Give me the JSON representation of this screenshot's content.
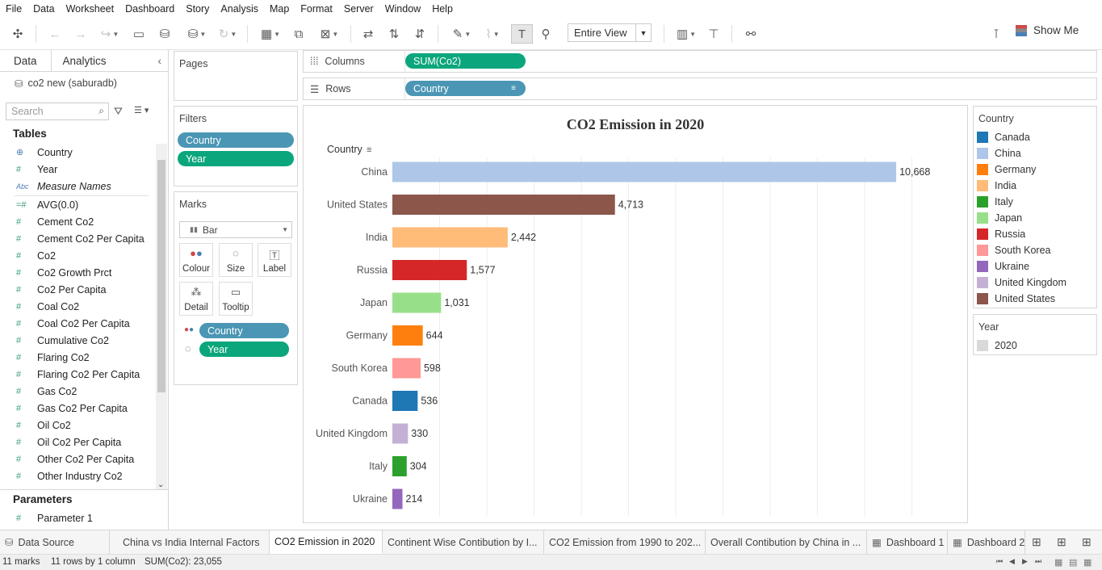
{
  "menu": [
    "File",
    "Data",
    "Worksheet",
    "Dashboard",
    "Story",
    "Analysis",
    "Map",
    "Format",
    "Server",
    "Window",
    "Help"
  ],
  "toolbar": {
    "fit_mode": "Entire View",
    "show_me": "Show Me"
  },
  "left_pane": {
    "tabs": [
      "Data",
      "Analytics"
    ],
    "datasource": "co2 new (saburadb)",
    "search_placeholder": "Search",
    "tables_heading": "Tables",
    "fields": [
      {
        "icon": "globe",
        "name": "Country"
      },
      {
        "icon": "#",
        "name": "Year"
      },
      {
        "icon": "Abc",
        "name": "Measure Names",
        "italic": true
      },
      {
        "icon": "=#",
        "name": "AVG(0.0)"
      },
      {
        "icon": "#",
        "name": "Cement Co2"
      },
      {
        "icon": "#",
        "name": "Cement Co2 Per Capita"
      },
      {
        "icon": "#",
        "name": "Co2"
      },
      {
        "icon": "#",
        "name": "Co2 Growth Prct"
      },
      {
        "icon": "#",
        "name": "Co2 Per Capita"
      },
      {
        "icon": "#",
        "name": "Coal Co2"
      },
      {
        "icon": "#",
        "name": "Coal Co2 Per Capita"
      },
      {
        "icon": "#",
        "name": "Cumulative Co2"
      },
      {
        "icon": "#",
        "name": "Flaring Co2"
      },
      {
        "icon": "#",
        "name": "Flaring Co2 Per Capita"
      },
      {
        "icon": "#",
        "name": "Gas Co2"
      },
      {
        "icon": "#",
        "name": "Gas Co2 Per Capita"
      },
      {
        "icon": "#",
        "name": "Oil Co2"
      },
      {
        "icon": "#",
        "name": "Oil Co2 Per Capita"
      },
      {
        "icon": "#",
        "name": "Other Co2 Per Capita"
      },
      {
        "icon": "#",
        "name": "Other Industry Co2"
      }
    ],
    "parameters_heading": "Parameters",
    "parameters": [
      {
        "icon": "#",
        "name": "Parameter 1"
      }
    ]
  },
  "cards": {
    "pages_label": "Pages",
    "filters_label": "Filters",
    "filters": [
      "Country",
      "Year"
    ],
    "marks_label": "Marks",
    "mark_type": "Bar",
    "mark_buttons": [
      "Colour",
      "Size",
      "Label",
      "Detail",
      "Tooltip"
    ],
    "mark_pills": [
      "Country",
      "Year"
    ]
  },
  "shelves": {
    "columns_label": "Columns",
    "columns_pill": "SUM(Co2)",
    "rows_label": "Rows",
    "rows_pill": "Country"
  },
  "chart_data": {
    "type": "bar",
    "orientation": "horizontal",
    "title": "CO2 Emission in 2020",
    "row_header": "Country",
    "categories": [
      "China",
      "United States",
      "India",
      "Russia",
      "Japan",
      "Germany",
      "South Korea",
      "Canada",
      "United Kingdom",
      "Italy",
      "Ukraine"
    ],
    "values": [
      10668,
      4713,
      2442,
      1577,
      1031,
      644,
      598,
      536,
      330,
      304,
      214
    ],
    "labels": [
      "10,668",
      "4,713",
      "2,442",
      "1,577",
      "1,031",
      "644",
      "598",
      "536",
      "330",
      "304",
      "214"
    ],
    "colors": [
      "#aec7e8",
      "#8c564b",
      "#ffbb78",
      "#d62728",
      "#98df8a",
      "#ff7f0e",
      "#ff9896",
      "#1f77b4",
      "#c5b0d5",
      "#2ca02c",
      "#9467bd"
    ],
    "xlim": [
      0,
      12000
    ],
    "grid": true
  },
  "legend_country": {
    "title": "Country",
    "items": [
      {
        "name": "Canada",
        "color": "#1f77b4"
      },
      {
        "name": "China",
        "color": "#aec7e8"
      },
      {
        "name": "Germany",
        "color": "#ff7f0e"
      },
      {
        "name": "India",
        "color": "#ffbb78"
      },
      {
        "name": "Italy",
        "color": "#2ca02c"
      },
      {
        "name": "Japan",
        "color": "#98df8a"
      },
      {
        "name": "Russia",
        "color": "#d62728"
      },
      {
        "name": "South Korea",
        "color": "#ff9896"
      },
      {
        "name": "Ukraine",
        "color": "#9467bd"
      },
      {
        "name": "United Kingdom",
        "color": "#c5b0d5"
      },
      {
        "name": "United States",
        "color": "#8c564b"
      }
    ]
  },
  "legend_year": {
    "title": "Year",
    "items": [
      {
        "name": "2020",
        "color": "#d9d9d9"
      }
    ]
  },
  "sheet_tabs": [
    "Data Source",
    "China vs India Internal Factors",
    "CO2 Emission in 2020",
    "Continent Wise Contibution by I...",
    "CO2 Emission from 1990 to 202...",
    "Overall Contibution by China in ...",
    "Dashboard 1",
    "Dashboard 2"
  ],
  "status": {
    "marks": "11 marks",
    "rows": "11 rows by 1 column",
    "sum": "SUM(Co2): 23,055"
  }
}
